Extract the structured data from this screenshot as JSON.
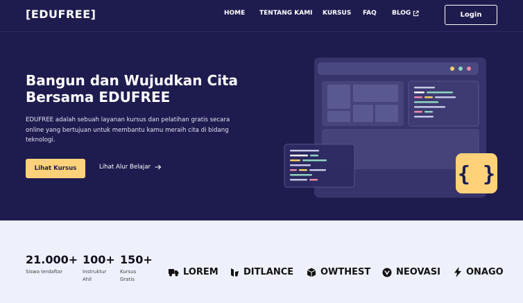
{
  "header": {
    "logo": "[EDUFREE]",
    "nav": [
      {
        "label": "HOME"
      },
      {
        "label": "TENTANG KAMI"
      },
      {
        "label": "KURSUS"
      },
      {
        "label": "FAQ"
      },
      {
        "label": "BLOG"
      }
    ],
    "login_label": "Login"
  },
  "hero": {
    "title_line1": "Bangun dan Wujudkan Cita",
    "title_line2": "Bersama EDUFREE",
    "description": "EDUFREE adalah sebuah layanan kursus dan pelatihan gratis secara online yang bertujuan untuk membantu kamu meraih cita di bidang teknologi.",
    "primary_button": "Lihat Kursus",
    "secondary_link": "Lihat Alur Belajar",
    "code_badge": "{ }"
  },
  "stats": [
    {
      "value": "21.000+",
      "label_line1": "Siswa terdaftar",
      "label_line2": ""
    },
    {
      "value": "100+",
      "label_line1": "Instruktur",
      "label_line2": "Ahli"
    },
    {
      "value": "150+",
      "label_line1": "Kursus",
      "label_line2": "Gratis"
    }
  ],
  "partners": [
    {
      "name": "LOREM",
      "icon": "truck-icon"
    },
    {
      "name": "DITLANCE",
      "icon": "ditlance-logo-icon"
    },
    {
      "name": "OWTHEST",
      "icon": "cube-icon"
    },
    {
      "name": "NEOVASI",
      "icon": "shield-icon"
    },
    {
      "name": "ONAGO",
      "icon": "bolt-icon"
    }
  ],
  "colors": {
    "hero_bg": "#1e1c4f",
    "accent": "#ffd27a",
    "section_bg": "#eef1fb"
  }
}
